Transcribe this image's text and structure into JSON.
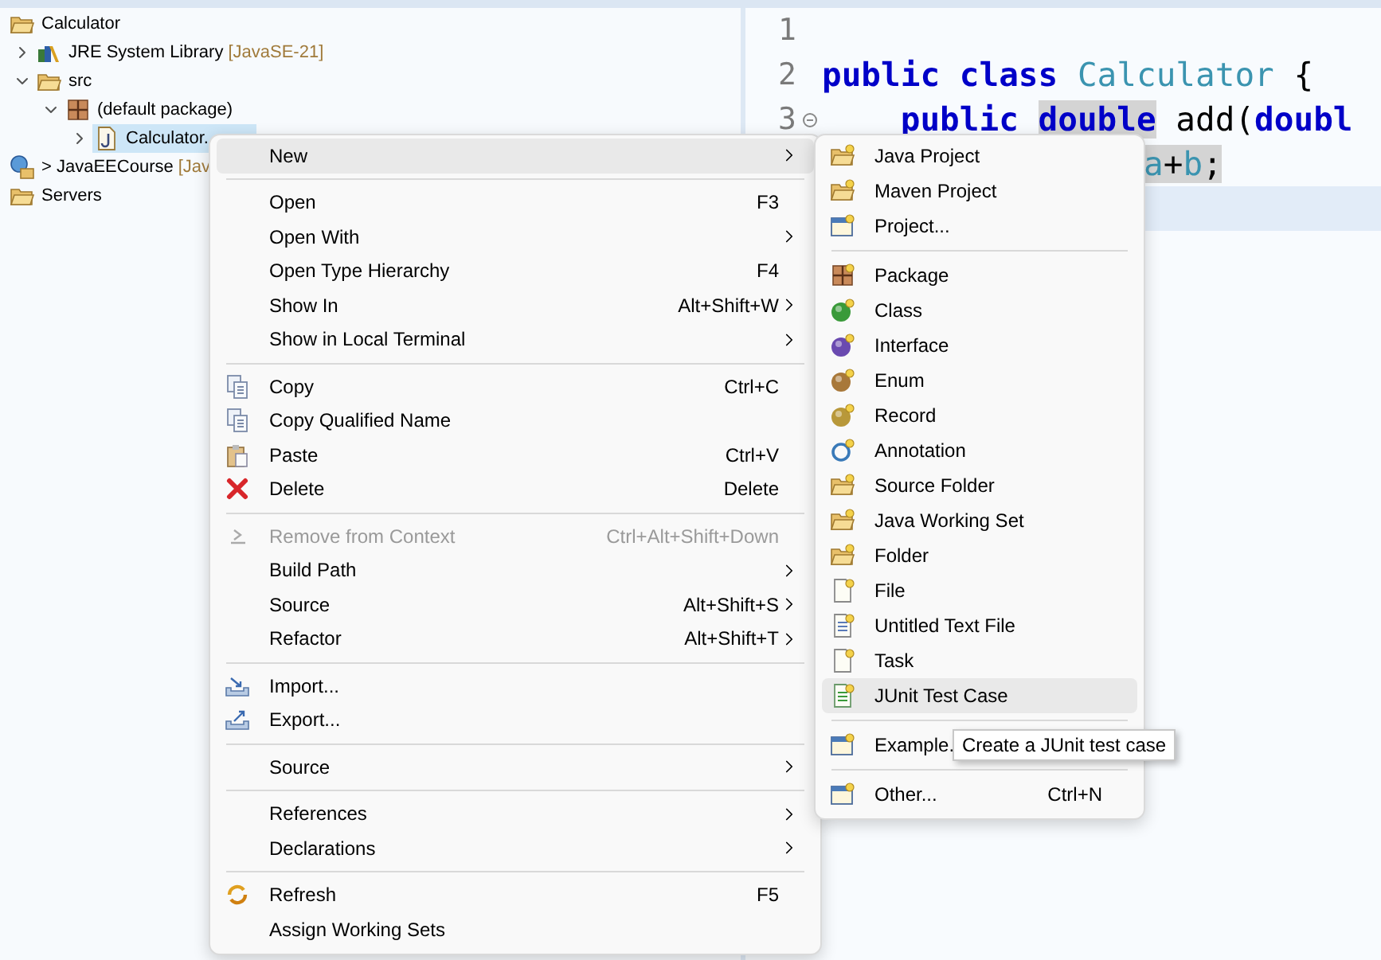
{
  "explorer": {
    "items": [
      {
        "label": "Calculator",
        "kind": "project",
        "children": [
          {
            "label": "JRE System Library",
            "decoration": "[JavaSE-21]",
            "kind": "library",
            "expanded": false,
            "selected": false
          },
          {
            "label": "src",
            "kind": "source-folder",
            "expanded": true,
            "selected": false,
            "children": [
              {
                "label": "(default package)",
                "kind": "package",
                "expanded": true,
                "selected": false,
                "children": [
                  {
                    "label": "Calculator.",
                    "kind": "java-file",
                    "expanded": false,
                    "selected": true
                  }
                ]
              }
            ]
          }
        ]
      },
      {
        "label": "> JavaEECourse",
        "decoration": "[Jav",
        "kind": "web-project"
      },
      {
        "label": "Servers",
        "kind": "folder"
      }
    ]
  },
  "editor": {
    "lines": [
      {
        "number": "1",
        "foldable": false,
        "current": false
      },
      {
        "number": "2",
        "foldable": false,
        "current": false,
        "tokens": [
          {
            "text": "public class ",
            "kind": "keyword",
            "marked": false
          },
          {
            "text": "Calculator",
            "kind": "type",
            "marked": false
          },
          {
            "text": " {",
            "kind": "plain",
            "marked": false
          }
        ]
      },
      {
        "number": "3",
        "foldable": true,
        "current": false,
        "tokens": [
          {
            "text": "    public ",
            "kind": "keyword",
            "marked": false
          },
          {
            "text": "double",
            "kind": "keyword",
            "marked": true
          },
          {
            "text": " add(",
            "kind": "plain",
            "marked": false
          },
          {
            "text": "doubl",
            "kind": "keyword",
            "marked": false
          }
        ]
      },
      {
        "foldable": false,
        "current": false,
        "tokens": [
          {
            "text": "a",
            "kind": "type",
            "marked": true
          },
          {
            "text": "+",
            "kind": "plain",
            "marked": true
          },
          {
            "text": "b",
            "kind": "type",
            "marked": true
          },
          {
            "text": ";",
            "kind": "plain",
            "marked": true
          }
        ]
      },
      {
        "foldable": false,
        "current": true
      }
    ]
  },
  "context_menu": {
    "items": [
      {
        "kind": "item",
        "label": "New",
        "submenu": true,
        "disabled": false,
        "selected": true
      },
      {
        "kind": "separator"
      },
      {
        "kind": "item",
        "label": "Open",
        "shortcut": "F3",
        "submenu": false,
        "disabled": false,
        "selected": false
      },
      {
        "kind": "item",
        "label": "Open With",
        "submenu": true,
        "disabled": false,
        "selected": false
      },
      {
        "kind": "item",
        "label": "Open Type Hierarchy",
        "shortcut": "F4",
        "submenu": false,
        "disabled": false,
        "selected": false
      },
      {
        "kind": "item",
        "label": "Show In",
        "shortcut": "Alt+Shift+W",
        "submenu": true,
        "disabled": false,
        "selected": false
      },
      {
        "kind": "item",
        "label": "Show in Local Terminal",
        "submenu": true,
        "disabled": false,
        "selected": false
      },
      {
        "kind": "separator"
      },
      {
        "kind": "item",
        "label": "Copy",
        "shortcut": "Ctrl+C",
        "submenu": false,
        "disabled": false,
        "selected": false
      },
      {
        "kind": "item",
        "label": "Copy Qualified Name",
        "submenu": false,
        "disabled": false,
        "selected": false
      },
      {
        "kind": "item",
        "label": "Paste",
        "shortcut": "Ctrl+V",
        "submenu": false,
        "disabled": false,
        "selected": false
      },
      {
        "kind": "item",
        "label": "Delete",
        "shortcut": "Delete",
        "submenu": false,
        "disabled": false,
        "selected": false
      },
      {
        "kind": "separator"
      },
      {
        "kind": "item",
        "label": "Remove from Context",
        "shortcut": "Ctrl+Alt+Shift+Down",
        "submenu": false,
        "disabled": true,
        "selected": false
      },
      {
        "kind": "item",
        "label": "Build Path",
        "submenu": true,
        "disabled": false,
        "selected": false
      },
      {
        "kind": "item",
        "label": "Source",
        "shortcut": "Alt+Shift+S",
        "submenu": true,
        "disabled": false,
        "selected": false
      },
      {
        "kind": "item",
        "label": "Refactor",
        "shortcut": "Alt+Shift+T",
        "submenu": true,
        "disabled": false,
        "selected": false
      },
      {
        "kind": "separator"
      },
      {
        "kind": "item",
        "label": "Import...",
        "submenu": false,
        "disabled": false,
        "selected": false
      },
      {
        "kind": "item",
        "label": "Export...",
        "submenu": false,
        "disabled": false,
        "selected": false
      },
      {
        "kind": "separator"
      },
      {
        "kind": "item",
        "label": "Source",
        "submenu": true,
        "disabled": false,
        "selected": false
      },
      {
        "kind": "separator"
      },
      {
        "kind": "item",
        "label": "References",
        "submenu": true,
        "disabled": false,
        "selected": false
      },
      {
        "kind": "item",
        "label": "Declarations",
        "submenu": true,
        "disabled": false,
        "selected": false
      },
      {
        "kind": "separator"
      },
      {
        "kind": "item",
        "label": "Refresh",
        "shortcut": "F5",
        "submenu": false,
        "disabled": false,
        "selected": false
      },
      {
        "kind": "item",
        "label": "Assign Working Sets",
        "submenu": false,
        "disabled": false,
        "selected": false
      }
    ]
  },
  "new_submenu": {
    "items": [
      {
        "kind": "item",
        "label": "Java Project",
        "selected": false
      },
      {
        "kind": "item",
        "label": "Maven Project",
        "selected": false
      },
      {
        "kind": "item",
        "label": "Project...",
        "selected": false
      },
      {
        "kind": "separator"
      },
      {
        "kind": "item",
        "label": "Package",
        "selected": false
      },
      {
        "kind": "item",
        "label": "Class",
        "selected": false
      },
      {
        "kind": "item",
        "label": "Interface",
        "selected": false
      },
      {
        "kind": "item",
        "label": "Enum",
        "selected": false
      },
      {
        "kind": "item",
        "label": "Record",
        "selected": false
      },
      {
        "kind": "item",
        "label": "Annotation",
        "selected": false
      },
      {
        "kind": "item",
        "label": "Source Folder",
        "selected": false
      },
      {
        "kind": "item",
        "label": "Java Working Set",
        "selected": false
      },
      {
        "kind": "item",
        "label": "Folder",
        "selected": false
      },
      {
        "kind": "item",
        "label": "File",
        "selected": false
      },
      {
        "kind": "item",
        "label": "Untitled Text File",
        "selected": false
      },
      {
        "kind": "item",
        "label": "Task",
        "selected": false
      },
      {
        "kind": "item",
        "label": "JUnit Test Case",
        "selected": true
      },
      {
        "kind": "separator"
      },
      {
        "kind": "item",
        "label": "Example.",
        "selected": false
      },
      {
        "kind": "separator"
      },
      {
        "kind": "item",
        "label": "Other...",
        "shortcut": "Ctrl+N",
        "selected": false
      }
    ]
  },
  "tooltip": {
    "text": "Create a JUnit test case"
  }
}
